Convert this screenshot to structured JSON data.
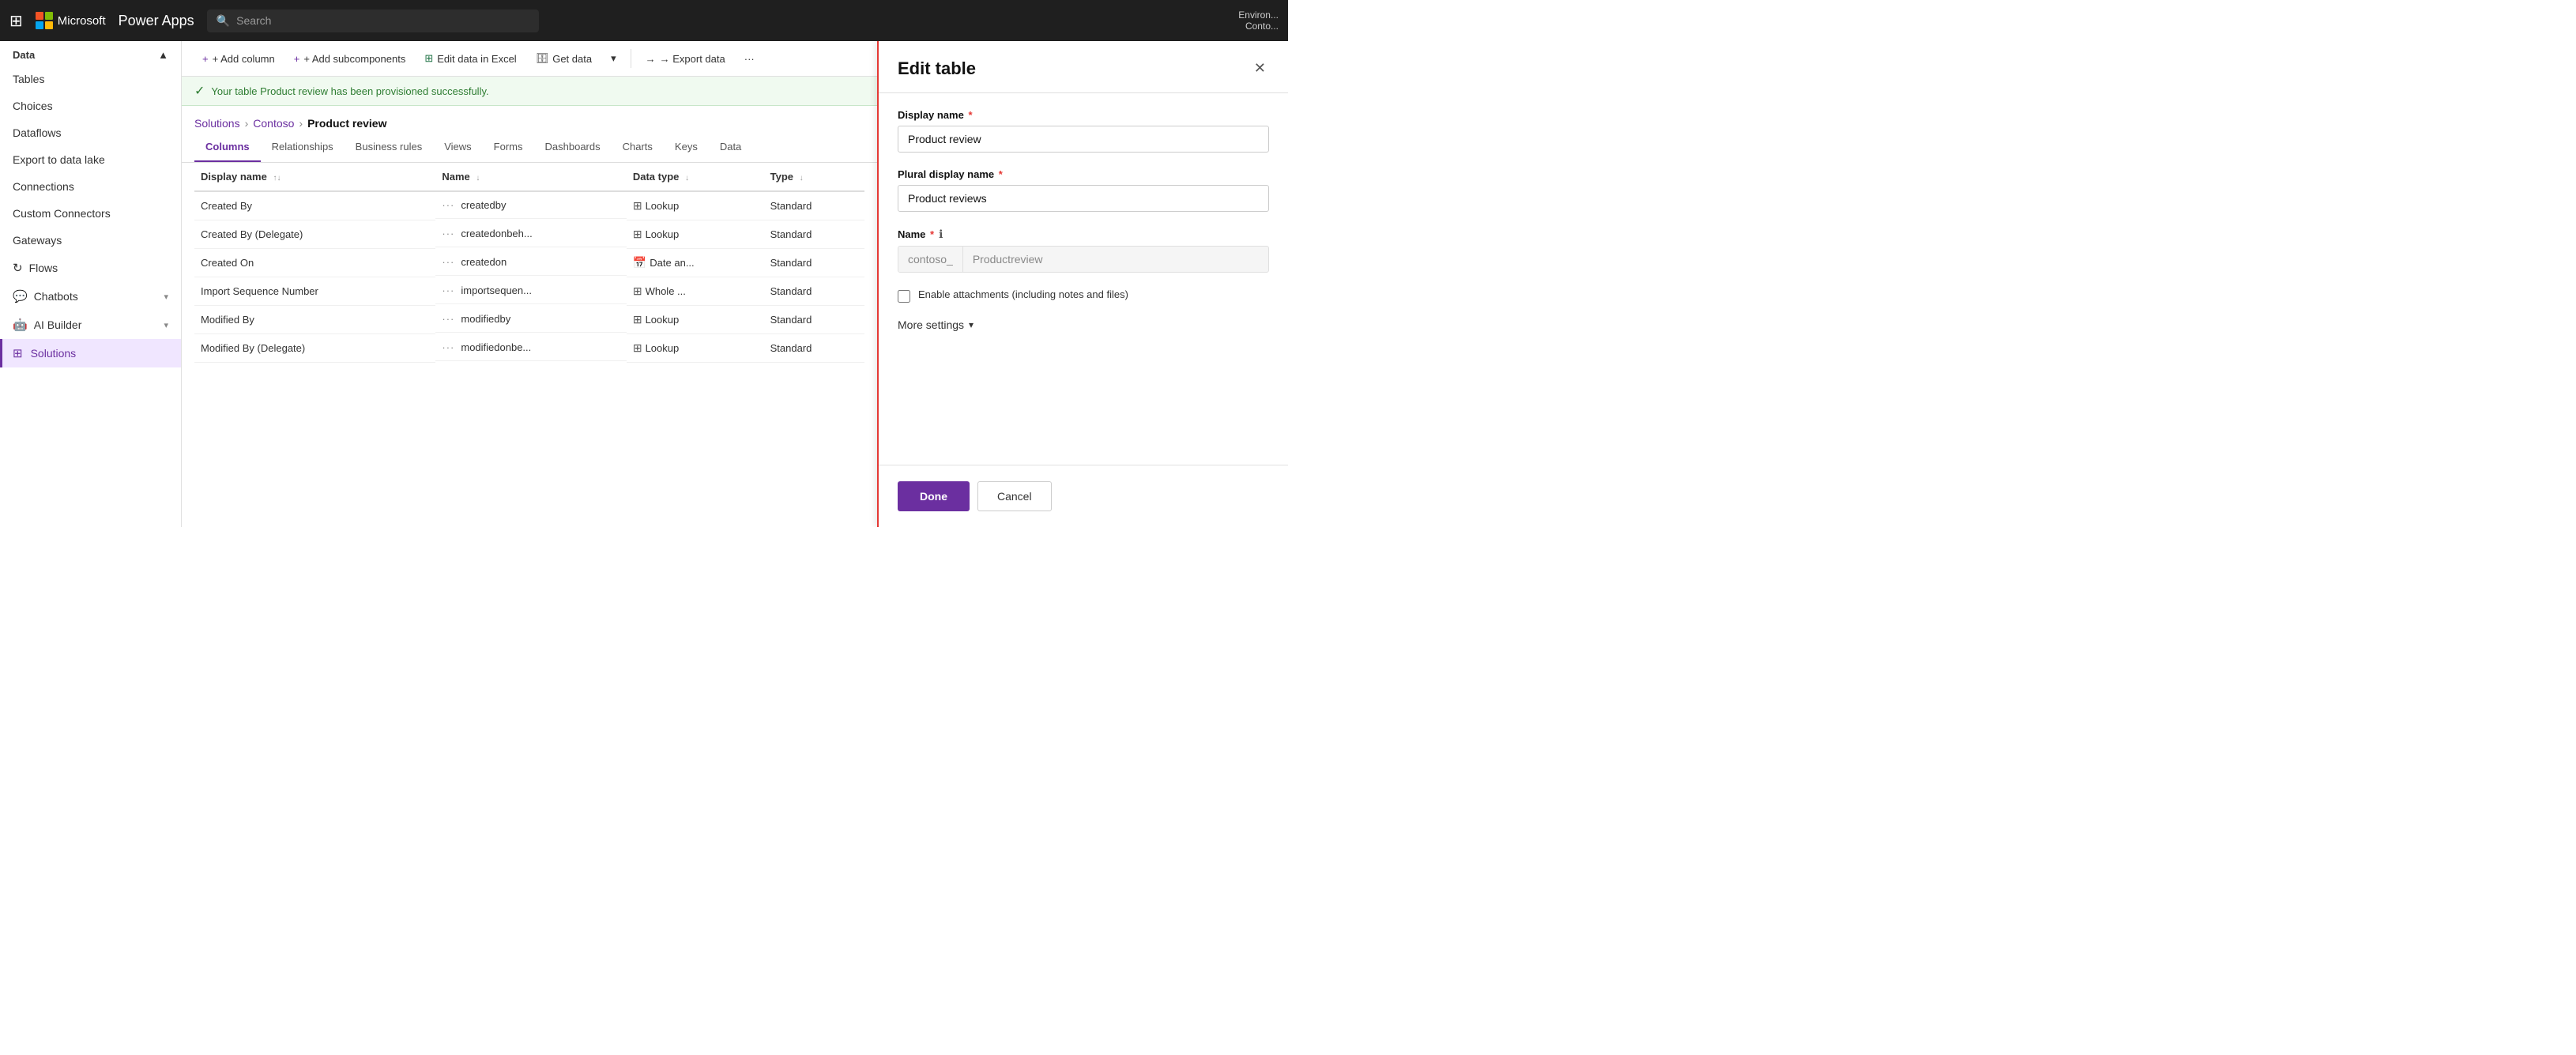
{
  "app": {
    "name": "Power Apps",
    "search_placeholder": "Search"
  },
  "env": {
    "label": "Environ...",
    "account": "Conto..."
  },
  "sidebar": {
    "section_header": "Data",
    "collapse_icon": "▲",
    "items": [
      {
        "id": "tables",
        "label": "Tables",
        "icon": ""
      },
      {
        "id": "choices",
        "label": "Choices",
        "icon": ""
      },
      {
        "id": "dataflows",
        "label": "Dataflows",
        "icon": ""
      },
      {
        "id": "export-lake",
        "label": "Export to data lake",
        "icon": ""
      },
      {
        "id": "connections",
        "label": "Connections",
        "icon": ""
      },
      {
        "id": "custom-connectors",
        "label": "Custom Connectors",
        "icon": ""
      },
      {
        "id": "gateways",
        "label": "Gateways",
        "icon": ""
      }
    ],
    "flows": {
      "label": "Flows",
      "icon": "↻"
    },
    "chatbots": {
      "label": "Chatbots",
      "icon": "💬"
    },
    "ai_builder": {
      "label": "AI Builder",
      "icon": "🤖"
    },
    "solutions": {
      "label": "Solutions",
      "icon": "⊞",
      "active": true
    }
  },
  "toolbar": {
    "add_column": "+ Add column",
    "add_subcomponents": "+ Add subcomponents",
    "edit_excel": "Edit data in Excel",
    "get_data": "Get data",
    "export_data": "→ Export data",
    "more": "..."
  },
  "success_banner": {
    "message": "Your table Product review has been provisioned successfully."
  },
  "breadcrumb": {
    "solutions": "Solutions",
    "contoso": "Contoso",
    "current": "Product review"
  },
  "tabs": [
    {
      "id": "columns",
      "label": "Columns",
      "active": true
    },
    {
      "id": "relationships",
      "label": "Relationships"
    },
    {
      "id": "business-rules",
      "label": "Business rules"
    },
    {
      "id": "views",
      "label": "Views"
    },
    {
      "id": "forms",
      "label": "Forms"
    },
    {
      "id": "dashboards",
      "label": "Dashboards"
    },
    {
      "id": "charts",
      "label": "Charts"
    },
    {
      "id": "keys",
      "label": "Keys"
    },
    {
      "id": "data",
      "label": "Data"
    }
  ],
  "table": {
    "columns": [
      {
        "id": "display-name",
        "label": "Display name",
        "sort": "↑↓"
      },
      {
        "id": "name",
        "label": "Name",
        "sort": "↓"
      },
      {
        "id": "data-type",
        "label": "Data type",
        "sort": "↓"
      },
      {
        "id": "type",
        "label": "Type",
        "sort": "↓"
      }
    ],
    "rows": [
      {
        "display_name": "Created By",
        "name": "createdby",
        "data_type": "Lookup",
        "type": "Standard",
        "type_icon": "⊞"
      },
      {
        "display_name": "Created By (Delegate)",
        "name": "createdonbeh...",
        "data_type": "Lookup",
        "type": "Standard",
        "type_icon": "⊞"
      },
      {
        "display_name": "Created On",
        "name": "createdon",
        "data_type": "Date an...",
        "type": "Standard",
        "type_icon": "📅"
      },
      {
        "display_name": "Import Sequence Number",
        "name": "importsequen...",
        "data_type": "Whole ...",
        "type": "Standard",
        "type_icon": "⊞"
      },
      {
        "display_name": "Modified By",
        "name": "modifiedby",
        "data_type": "Lookup",
        "type": "Standard",
        "type_icon": "⊞"
      },
      {
        "display_name": "Modified By (Delegate)",
        "name": "modifiedonbe...",
        "data_type": "Lookup",
        "type": "Standard",
        "type_icon": "⊞"
      }
    ]
  },
  "edit_panel": {
    "title": "Edit table",
    "display_name_label": "Display name",
    "display_name_value": "Product review",
    "plural_name_label": "Plural display name",
    "plural_name_value": "Product reviews",
    "name_label": "Name",
    "name_prefix": "contoso_",
    "name_value": "Productreview",
    "enable_attachments_label": "Enable attachments (including notes and files)",
    "more_settings_label": "More settings",
    "done_label": "Done",
    "cancel_label": "Cancel"
  }
}
